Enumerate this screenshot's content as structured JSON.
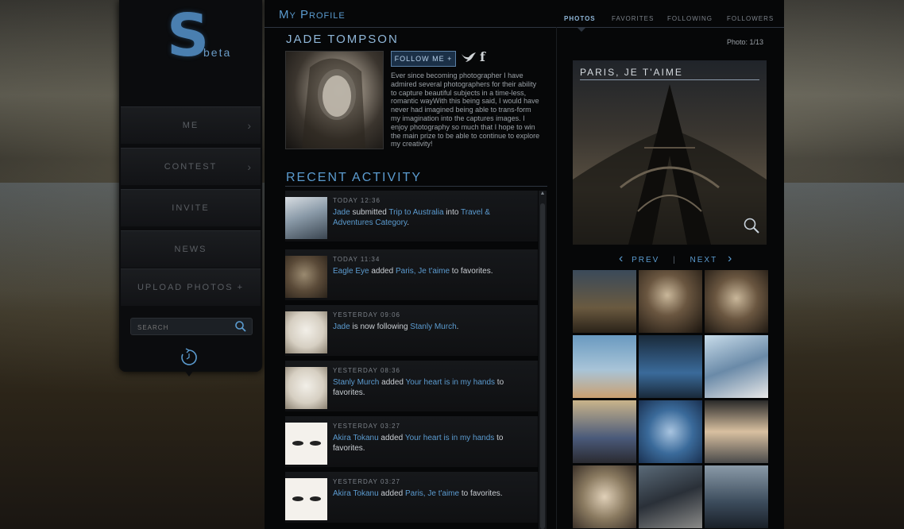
{
  "sidebar": {
    "logo_letter": "S",
    "logo_beta": "beta",
    "items": [
      {
        "label": "ME",
        "chevron": "›"
      },
      {
        "label": "CONTEST",
        "chevron": "›"
      },
      {
        "label": "INVITE",
        "chevron": ""
      },
      {
        "label": "NEWS",
        "chevron": ""
      },
      {
        "label": "UPLOAD PHOTOS +",
        "chevron": ""
      }
    ],
    "search_placeholder": "SEARCH"
  },
  "header": {
    "title": "My Profile",
    "tabs": [
      "PHOTOS",
      "FAVORITES",
      "FOLLOWING",
      "FOLLOWERS"
    ],
    "active_tab": "PHOTOS"
  },
  "profile": {
    "name": "JADE TOMPSON",
    "follow_label": "FOLLOW ME +",
    "bio": "Ever since becoming photographer I have admired several photographers for their ability to capture beautiful subjects in a time-less, romantic wayWith this being said, I would have never had imagined being able to trans-form my imagination into the captures images. I enjoy photography so much that I hope to win the main prize to be able to continue to explore my creativity!"
  },
  "activity": {
    "title": "RECENT ACTIVITY",
    "items": [
      {
        "time": "TODAY 12:36",
        "user": "Jade",
        "verb": " submitted ",
        "object": "Trip to Australia",
        "mid": " into ",
        "target": "Travel & Adventures Category",
        "end": "."
      },
      {
        "time": "TODAY 11:34",
        "user": "Eagle Eye",
        "verb": " added ",
        "object": "Paris, Je t'aime",
        "mid": " to favorites.",
        "target": "",
        "end": ""
      },
      {
        "time": "YESTERDAY 09:06",
        "user": "Jade",
        "verb": " is now following ",
        "object": "Stanly Murch",
        "mid": ".",
        "target": "",
        "end": ""
      },
      {
        "time": "YESTERDAY 08:36",
        "user": "Stanly Murch",
        "verb": " added ",
        "object": "Your heart is in my hands",
        "mid": " to favorites.",
        "target": "",
        "end": ""
      },
      {
        "time": "YESTERDAY 03:27",
        "user": "Akira Tokanu",
        "verb": " added ",
        "object": "Your heart is in my hands",
        "mid": " to favorites.",
        "target": "",
        "end": ""
      },
      {
        "time": "YESTERDAY 03:27",
        "user": "Akira Tokanu",
        "verb": " added ",
        "object": "Paris, Je t'aime",
        "mid": " to favorites.",
        "target": "",
        "end": ""
      }
    ]
  },
  "gallery": {
    "counter": "Photo: 1/13",
    "featured_title": "PARIS, JE T'AIME",
    "prev_label": "PREV",
    "next_label": "NEXT",
    "separator": "|",
    "prev_chevron": "‹",
    "next_chevron": "›"
  },
  "colors": {
    "accent": "#5b9bcf",
    "panel": "#060708"
  }
}
